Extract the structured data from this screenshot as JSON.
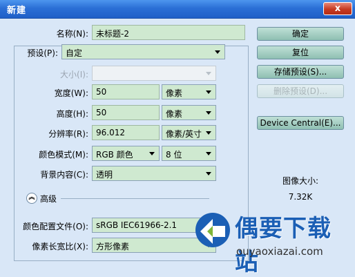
{
  "window": {
    "title": "新建",
    "close": "x"
  },
  "form": {
    "name_label": "名称(N):",
    "name_value": "未标题-2",
    "preset_label": "预设(P):",
    "preset_value": "自定",
    "size_label": "大小(I):",
    "size_value": "",
    "width_label": "宽度(W):",
    "width_value": "50",
    "width_unit": "像素",
    "height_label": "高度(H):",
    "height_value": "50",
    "height_unit": "像素",
    "resolution_label": "分辨率(R):",
    "resolution_value": "96.012",
    "resolution_unit": "像素/英寸",
    "color_mode_label": "颜色模式(M):",
    "color_mode_value": "RGB 颜色",
    "bit_depth_value": "8 位",
    "background_label": "背景内容(C):",
    "background_value": "透明",
    "advanced_label": "高级",
    "color_profile_label": "颜色配置文件(O):",
    "color_profile_value": "sRGB IEC61966-2.1",
    "pixel_aspect_label": "像素长宽比(X):",
    "pixel_aspect_value": "方形像素"
  },
  "buttons": {
    "ok": "确定",
    "reset": "复位",
    "save_preset": "存储预设(S)...",
    "delete_preset": "删除预设(D)...",
    "device_central": "Device Central(E)..."
  },
  "image_size": {
    "label": "图像大小:",
    "value": "7.32K"
  },
  "watermark": {
    "text": "偶要下载站",
    "url": "ouyaoxiazai.com"
  },
  "colors": {
    "titlebar": "#2b6fd6",
    "dialog_bg": "#d9e7f7",
    "field_bg": "#cfe9d0"
  }
}
